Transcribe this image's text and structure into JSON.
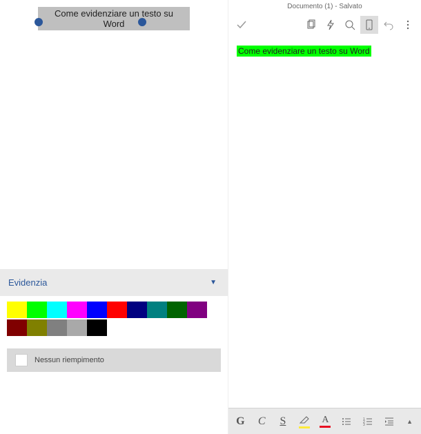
{
  "left": {
    "selected_text": "Come evidenziare un testo su Word",
    "panel": {
      "title": "Evidenzia",
      "colors_row1": [
        "#ffff00",
        "#00ff00",
        "#00ffff",
        "#ff00ff",
        "#0000ff",
        "#ff0000",
        "#000080",
        "#008080",
        "#006400",
        "#800080"
      ],
      "colors_row2": [
        "#800000",
        "#808000",
        "#808080",
        "#a9a9a9",
        "#000000"
      ],
      "no_fill_label": "Nessun riempimento"
    }
  },
  "right": {
    "doc_title": "Documento (1) - Salvato",
    "highlighted_text": "Come evidenziare un testo su Word",
    "bottom": {
      "bold": "G",
      "italic": "C",
      "underline": "S",
      "font_color_letter": "A"
    }
  }
}
